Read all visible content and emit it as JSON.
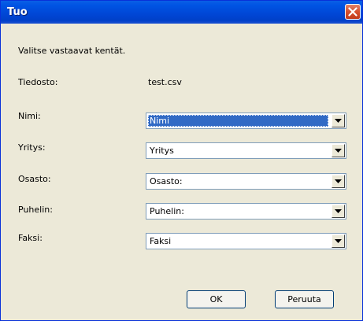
{
  "window": {
    "title": "Tuo"
  },
  "intro": "Valitse vastaavat kentät.",
  "file": {
    "label": "Tiedosto:",
    "value": "test.csv"
  },
  "fields": [
    {
      "label": "Nimi:",
      "value": "Nimi"
    },
    {
      "label": "Yritys:",
      "value": "Yritys"
    },
    {
      "label": "Osasto:",
      "value": "Osasto:"
    },
    {
      "label": "Puhelin:",
      "value": "Puhelin:"
    },
    {
      "label": "Faksi:",
      "value": "Faksi"
    }
  ],
  "buttons": {
    "ok": "OK",
    "cancel": "Peruuta"
  },
  "icons": {
    "close": "close-icon",
    "dropdown": "chevron-down-icon"
  }
}
